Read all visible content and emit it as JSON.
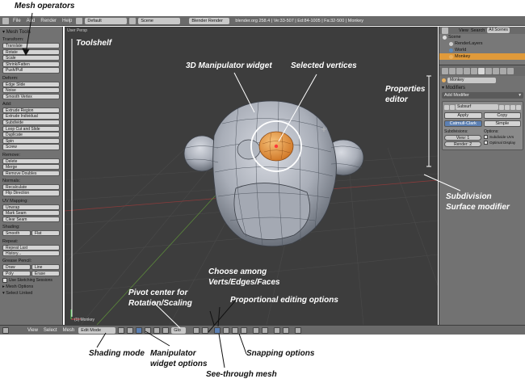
{
  "top_bar": {
    "menus": [
      "File",
      "Add",
      "Render",
      "Help"
    ],
    "layout": "Default",
    "scene": "Scene",
    "engine": "Blender Render",
    "info": "blender.org 258.4 | Ve:33-507 | Ed:84-1005 | Fa:32-500 | Monkey"
  },
  "toolshelf": {
    "title": "Mesh Tools",
    "sections": [
      {
        "label": "Transform:",
        "buttons": [
          "Translate",
          "Rotate",
          "Scale",
          "Shrink/Fatten",
          "Push/Pull"
        ]
      },
      {
        "label": "Deform:",
        "buttons": [
          "Edge Slide",
          "Noise",
          "Smooth Vertex"
        ]
      },
      {
        "label": "Add:",
        "buttons": [
          "Extrude Region",
          "Extrude Individual",
          "Subdivide",
          "Loop Cut and Slide",
          "Duplicate",
          "Spin",
          "Screw"
        ]
      },
      {
        "label": "Remove:",
        "buttons": [
          "Delete",
          "Merge",
          "Remove Doubles"
        ]
      },
      {
        "label": "Normals:",
        "buttons": [
          "Recalculate",
          "Flip Direction"
        ]
      },
      {
        "label": "UV Mapping:",
        "buttons": [
          "Unwrap",
          "Mark Seam",
          "Clear Seam"
        ]
      }
    ],
    "shading_label": "Shading:",
    "shading_buttons": [
      "Smooth",
      "Flat"
    ],
    "repeat_label": "Repeat:",
    "repeat_buttons": [
      "Repeat Last",
      "History..."
    ],
    "grease_label": "Grease Pencil:",
    "grease_rows": [
      [
        "Draw",
        "Line"
      ],
      [
        "Poly",
        "Erase"
      ]
    ],
    "sketch_check": "Use Sketching Sessions",
    "mesh_options": "Mesh Options",
    "select_linked": "Select Linked"
  },
  "viewport": {
    "title": "User Persp",
    "object_label": "(1) Monkey"
  },
  "bottom_bar": {
    "menus": [
      "View",
      "Select",
      "Mesh"
    ],
    "mode": "Edit Mode",
    "global": "Glo"
  },
  "outliner": {
    "menus": [
      "View",
      "Search"
    ],
    "filter": "All Scenes",
    "items": [
      "Scene",
      "RenderLayers",
      "World",
      "Monkey"
    ]
  },
  "properties": {
    "object_name": "Monkey",
    "section": "Modifiers",
    "add_modifier": "Add Modifier",
    "modifier_name": "Subsurf",
    "apply": "Apply",
    "copy": "Copy",
    "catmull": "Catmull-Clark",
    "simple": "Simple",
    "subdivisions_label": "Subdivisions:",
    "options_label": "Options:",
    "view_value": "View: 1",
    "render_value": "Render: 2",
    "opt1": "Subdivide UVs",
    "opt2": "Optimal Display"
  },
  "callouts": {
    "mesh_operators": "Mesh operators",
    "toolshelf": "Toolshelf",
    "manipulator_widget": "3D Manipulator widget",
    "selected_vertices": "Selected vertices",
    "properties_editor_1": "Properties",
    "properties_editor_2": "editor",
    "subdivision_1": "Subdivision",
    "subdivision_2": "Surface modifier",
    "choose_among_1": "Choose among",
    "choose_among_2": "Verts/Edges/Faces",
    "pivot_1": "Pivot center for",
    "pivot_2": "Rotation/Scaling",
    "proportional": "Proportional editing options",
    "shading_mode": "Shading mode",
    "manip_options_1": "Manipulator",
    "manip_options_2": "widget options",
    "see_through": "See-through mesh",
    "snapping": "Snapping options"
  },
  "colors": {
    "viewport_bg": "#3d3d3d",
    "panel_bg": "#727272",
    "selection": "#e08a30",
    "active_blue": "#5c80b3"
  }
}
